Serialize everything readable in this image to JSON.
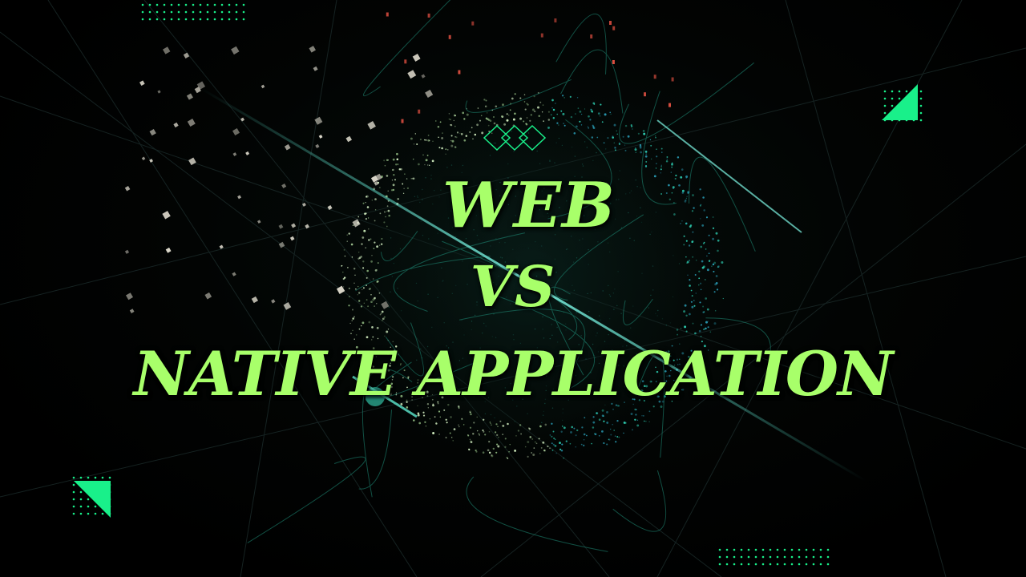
{
  "slide": {
    "line1": "WEB",
    "line2": "VS",
    "line3": "NATIVE APPLICATION"
  },
  "colors": {
    "title": "#a8ff6a",
    "accent": "#19f08a",
    "globe": "#2fd6b8",
    "particles": "#d9f5c6",
    "sparks": "#ff5a4a",
    "background": "#000000"
  },
  "decorations": {
    "top_left": "dot-grid",
    "top_right": "triangle-with-dot-grid",
    "bottom_left": "triangle-with-dot-grid",
    "bottom_right": "dot-grid",
    "center_top": "three-diamond-outline",
    "centerpiece": "particle-globe"
  }
}
